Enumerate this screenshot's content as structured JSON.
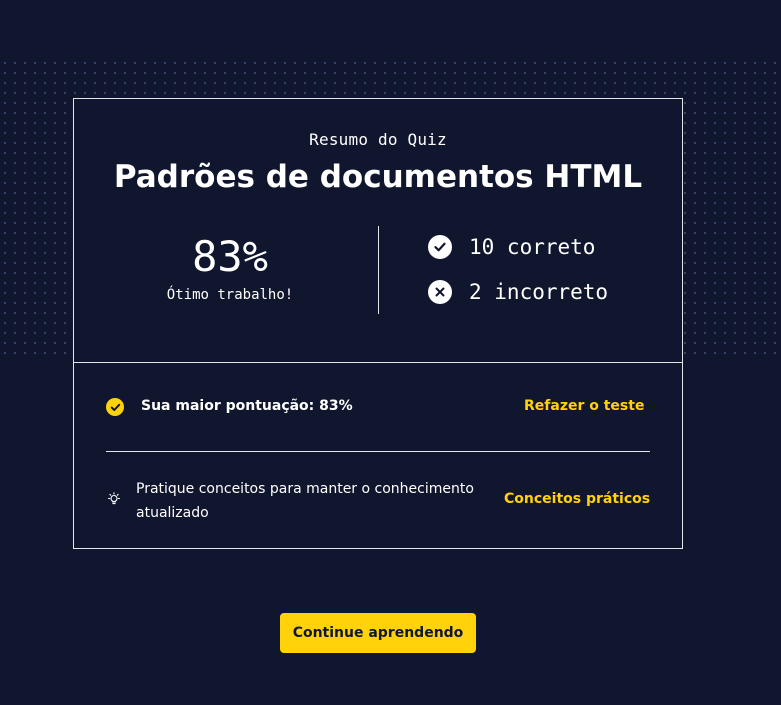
{
  "summary": {
    "eyebrow": "Resumo do Quiz",
    "title": "Padrões de documentos HTML",
    "score_percent": "83%",
    "score_message": "Ótimo trabalho!",
    "correct_label": "10 correto",
    "incorrect_label": "2 incorreto"
  },
  "best_score": {
    "text": "Sua maior pontuação: 83%",
    "retake_link": "Refazer o teste"
  },
  "practice": {
    "text": "Pratique conceitos para manter o conhecimento atualizado",
    "link": "Conceitos práticos"
  },
  "continue_button": "Continue aprendendo",
  "colors": {
    "background": "#11162f",
    "accent": "#ffd20a",
    "text": "#ffffff"
  },
  "icons": {
    "correct": "check-circle-icon",
    "incorrect": "x-circle-icon",
    "best": "yellow-check-icon",
    "practice": "lightbulb-icon"
  }
}
